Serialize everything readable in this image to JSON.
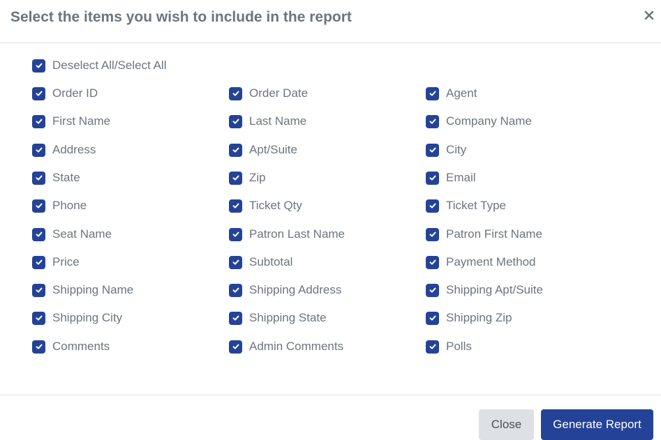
{
  "dialog": {
    "title": "Select the items you wish to include in the report",
    "close_icon": "close-x-icon"
  },
  "select_all": {
    "label": "Deselect All/Select All",
    "checked": true
  },
  "items": [
    {
      "label": "Order ID",
      "checked": true
    },
    {
      "label": "Order Date",
      "checked": true
    },
    {
      "label": "Agent",
      "checked": true
    },
    {
      "label": "First Name",
      "checked": true
    },
    {
      "label": "Last Name",
      "checked": true
    },
    {
      "label": "Company Name",
      "checked": true
    },
    {
      "label": "Address",
      "checked": true
    },
    {
      "label": "Apt/Suite",
      "checked": true
    },
    {
      "label": "City",
      "checked": true
    },
    {
      "label": "State",
      "checked": true
    },
    {
      "label": "Zip",
      "checked": true
    },
    {
      "label": "Email",
      "checked": true
    },
    {
      "label": "Phone",
      "checked": true
    },
    {
      "label": "Ticket Qty",
      "checked": true
    },
    {
      "label": "Ticket Type",
      "checked": true
    },
    {
      "label": "Seat Name",
      "checked": true
    },
    {
      "label": "Patron Last Name",
      "checked": true
    },
    {
      "label": "Patron First Name",
      "checked": true
    },
    {
      "label": "Price",
      "checked": true
    },
    {
      "label": "Subtotal",
      "checked": true
    },
    {
      "label": "Payment Method",
      "checked": true
    },
    {
      "label": "Shipping Name",
      "checked": true
    },
    {
      "label": "Shipping Address",
      "checked": true
    },
    {
      "label": "Shipping Apt/Suite",
      "checked": true
    },
    {
      "label": "Shipping City",
      "checked": true
    },
    {
      "label": "Shipping State",
      "checked": true
    },
    {
      "label": "Shipping Zip",
      "checked": true
    },
    {
      "label": "Comments",
      "checked": true
    },
    {
      "label": "Admin Comments",
      "checked": true
    },
    {
      "label": "Polls",
      "checked": true
    }
  ],
  "footer": {
    "close_label": "Close",
    "generate_label": "Generate Report"
  },
  "colors": {
    "accent": "#244398",
    "text": "#6c757d",
    "secondary_button": "#dde1e6"
  }
}
